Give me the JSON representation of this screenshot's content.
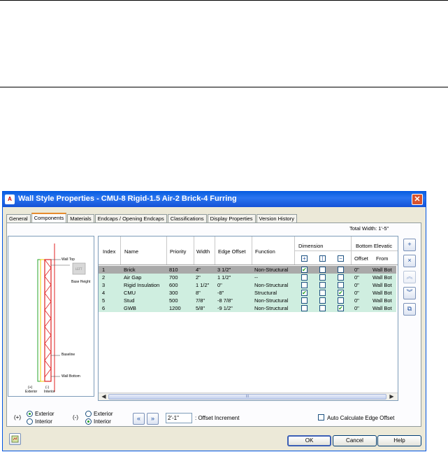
{
  "dialog": {
    "title": "Wall Style Properties - CMU-8 Rigid-1.5 Air-2 Brick-4 Furring",
    "app_icon": "A",
    "close_glyph": "✕"
  },
  "tabs": [
    {
      "label": "General"
    },
    {
      "label": "Components",
      "active": true
    },
    {
      "label": "Materials"
    },
    {
      "label": "Endcaps / Opening Endcaps"
    },
    {
      "label": "Classifications"
    },
    {
      "label": "Display Properties"
    },
    {
      "label": "Version History"
    }
  ],
  "total_width": "Total Width: 1'-5\"",
  "preview": {
    "labels": {
      "wall_top": "Wall Top",
      "base_height": "Base Height",
      "baseline": "Baseline",
      "wall_bottom": "Wall Bottom",
      "exterior": "Exterior",
      "interior": "Interior",
      "plus": "(+)",
      "minus": "(-)"
    }
  },
  "grid": {
    "headers": {
      "index": "Index",
      "name": "Name",
      "priority": "Priority",
      "width": "Width",
      "edge_offset": "Edge Offset",
      "function": "Function",
      "dimension": "Dimension",
      "bottom_elevation": "Bottom Elevatic",
      "offset": "Offset",
      "from": "From"
    },
    "rows": [
      {
        "index": "1",
        "name": "Brick",
        "priority": "810",
        "width": "4\"",
        "edge_offset": "3 1/2\"",
        "function": "Non-Structural",
        "d1": true,
        "d2": false,
        "d3": false,
        "offset": "0\"",
        "from": "Wall Bot",
        "selected": true
      },
      {
        "index": "2",
        "name": "Air Gap",
        "priority": "700",
        "width": "2\"",
        "edge_offset": "1 1/2\"",
        "function": "--",
        "d1": false,
        "d2": false,
        "d3": false,
        "offset": "0\"",
        "from": "Wall Bot"
      },
      {
        "index": "3",
        "name": "Rigid Insulation",
        "priority": "600",
        "width": "1 1/2\"",
        "edge_offset": "0\"",
        "function": "Non-Structural",
        "d1": false,
        "d2": false,
        "d3": false,
        "offset": "0\"",
        "from": "Wall Bot"
      },
      {
        "index": "4",
        "name": "CMU",
        "priority": "300",
        "width": "8\"",
        "edge_offset": "-8\"",
        "function": "Structural",
        "d1": true,
        "d2": false,
        "d3": true,
        "offset": "0\"",
        "from": "Wall Bot"
      },
      {
        "index": "5",
        "name": "Stud",
        "priority": "500",
        "width": "7/8\"",
        "edge_offset": "-8 7/8\"",
        "function": "Non-Structural",
        "d1": false,
        "d2": false,
        "d3": false,
        "offset": "0\"",
        "from": "Wall Bot"
      },
      {
        "index": "6",
        "name": "GWB",
        "priority": "1200",
        "width": "5/8\"",
        "edge_offset": "-9 1/2\"",
        "function": "Non-Structural",
        "d1": false,
        "d2": false,
        "d3": true,
        "offset": "0\"",
        "from": "Wall Bot"
      }
    ],
    "scroll_thumb": "III"
  },
  "side_buttons": [
    {
      "name": "add-component-icon",
      "glyph": "+"
    },
    {
      "name": "remove-component-icon",
      "glyph": "×"
    },
    {
      "name": "move-up-icon",
      "glyph": "︽"
    },
    {
      "name": "move-down-icon",
      "glyph": "︾"
    },
    {
      "name": "copy-component-icon",
      "glyph": "⧉"
    }
  ],
  "bottom": {
    "plus": "(+)",
    "minus": "(-)",
    "left_group": {
      "exterior": "Exterior",
      "interior": "Interior",
      "selected": "exterior"
    },
    "right_group": {
      "exterior": "Exterior",
      "interior": "Interior",
      "selected": "interior"
    },
    "nav_left": "«",
    "nav_right": "»",
    "offset_increment_value": "2'-1\"",
    "offset_increment_label": ": Offset Increment",
    "auto_calc_label": "Auto Calculate Edge Offset",
    "auto_calc_checked": false
  },
  "buttons": {
    "ok": "OK",
    "cancel": "Cancel",
    "help": "Help"
  }
}
